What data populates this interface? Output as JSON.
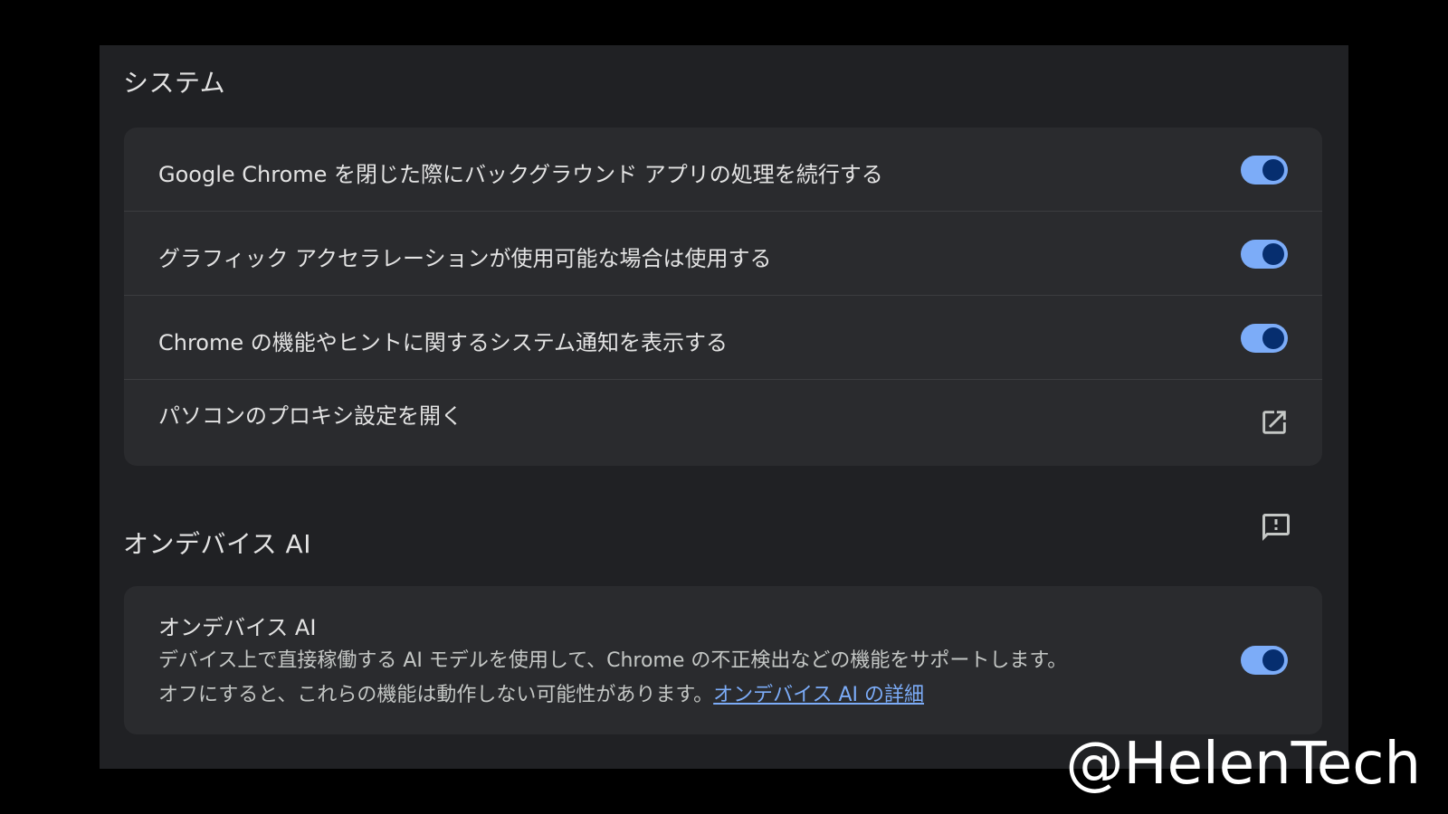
{
  "sections": {
    "system": {
      "title": "システム",
      "rows": [
        {
          "label": "Google Chrome を閉じた際にバックグラウンド アプリの処理を続行する",
          "toggle": "on"
        },
        {
          "label": "グラフィック アクセラレーションが使用可能な場合は使用する",
          "toggle": "on"
        },
        {
          "label": "Chrome の機能やヒントに関するシステム通知を表示する",
          "toggle": "on"
        },
        {
          "label": "パソコンのプロキシ設定を開く",
          "icon": "open-in-new-icon"
        }
      ]
    },
    "ai": {
      "title": "オンデバイス AI",
      "feedback_icon": "feedback-icon",
      "row": {
        "title": "オンデバイス AI",
        "desc_line1": "デバイス上で直接稼働する AI モデルを使用して、Chrome の不正検出などの機能をサポートします。",
        "desc_line2": "オフにすると、これらの機能は動作しない可能性があります。",
        "link": "オンデバイス AI の詳細",
        "toggle": "on"
      }
    }
  },
  "watermark": "@HelenTech",
  "colors": {
    "page_bg": "#000000",
    "panel_bg": "#202124",
    "card_bg": "#2a2b2e",
    "toggle_track": "#7cacf8",
    "toggle_knob": "#062e6f",
    "link": "#7cacf8"
  }
}
